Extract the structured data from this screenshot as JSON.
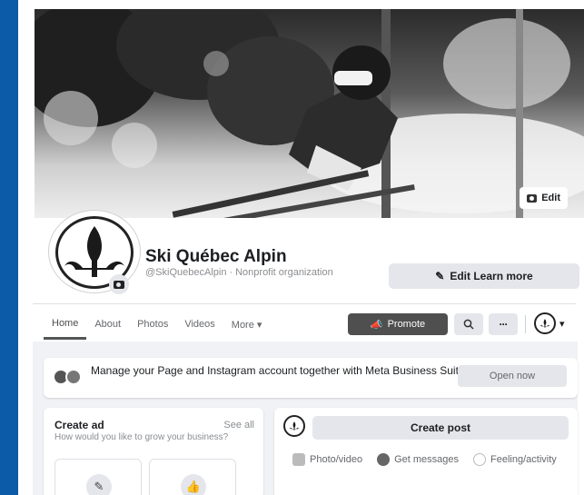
{
  "cover": {
    "edit_label": "Edit"
  },
  "page": {
    "name": "Ski Québec Alpin",
    "handle": "@SkiQuebecAlpin",
    "separator": "·",
    "category": "Nonprofit organization",
    "edit_learn_label": "Edit Learn more"
  },
  "tabs": [
    {
      "label": "Home",
      "active": true
    },
    {
      "label": "About"
    },
    {
      "label": "Photos"
    },
    {
      "label": "Videos"
    },
    {
      "label": "More ▾"
    }
  ],
  "actions": {
    "promote_label": "Promote",
    "search_icon": "search-icon",
    "more_label": "···",
    "menu_caret": "▾"
  },
  "business_suite": {
    "text": "Manage your Page and Instagram account together with Meta Business Suite.",
    "button_label": "Open now"
  },
  "create_ad": {
    "title": "Create ad",
    "see_all": "See all",
    "subtitle": "How would you like to grow your business?"
  },
  "create_post": {
    "button_label": "Create post",
    "actions": [
      {
        "label": "Photo/video",
        "icon": "photo-icon"
      },
      {
        "label": "Get messages",
        "icon": "messenger-icon"
      },
      {
        "label": "Feeling/activity",
        "icon": "smiley-icon"
      }
    ]
  },
  "colors": {
    "brand_blue": "#0b5ba8",
    "promote": "#4f4f4f",
    "button_gray": "#e4e6eb"
  }
}
